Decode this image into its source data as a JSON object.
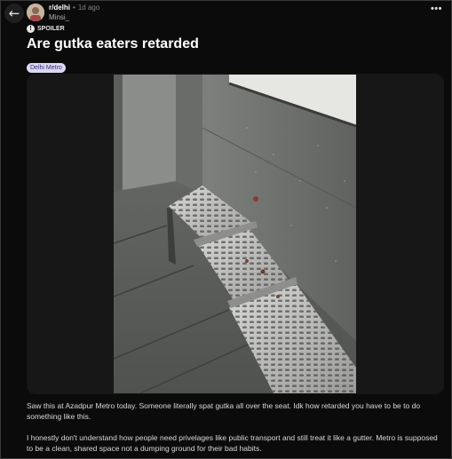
{
  "header": {
    "back_icon": "arrow-left-icon",
    "subreddit": "r/delhi",
    "separator": "•",
    "time": "1d ago",
    "author": "Minsi_",
    "more_icon": "more-horizontal-icon",
    "more_label": "•••"
  },
  "post": {
    "spoiler_icon": "exclamation-circle-icon",
    "spoiler_label": "SPOILER",
    "title": "Are gutka eaters retarded",
    "flair": "Delhi Metro",
    "paragraphs": [
      "Saw this at Azadpur Metro today. Someone literally spat gutka all over the seat. Idk how retarded you have to be to do something like this.",
      "I honestly don't understand how people need privelages like public transport and still treat it like a gutter. Metro is supposed to be a clean, shared space not a dumping ground for their bad habits."
    ]
  },
  "colors": {
    "background": "#0b0b0b",
    "title": "#ffffff",
    "body_text": "#d7dadc",
    "muted": "#818384",
    "flair_bg": "#dcd8f3",
    "flair_text": "#33307a"
  }
}
